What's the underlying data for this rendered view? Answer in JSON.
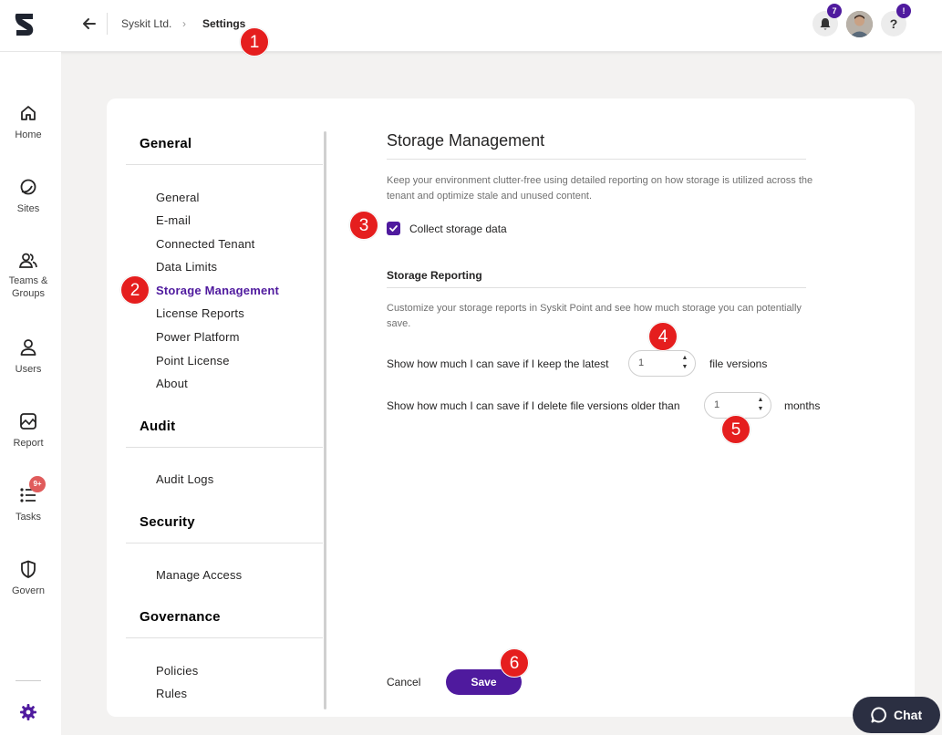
{
  "header": {
    "breadcrumb": {
      "org": "Syskit Ltd.",
      "chevron": "›",
      "current": "Settings"
    },
    "notifications_count": "7",
    "help_label": "?",
    "help_badge": "!"
  },
  "rail": {
    "items": [
      {
        "label": "Home",
        "icon": "home-icon"
      },
      {
        "label": "Sites",
        "icon": "sites-icon"
      },
      {
        "label": "Teams &\nGroups",
        "icon": "teams-icon"
      },
      {
        "label": "Users",
        "icon": "user-icon"
      },
      {
        "label": "Report",
        "icon": "report-icon"
      },
      {
        "label": "Tasks",
        "icon": "tasks-icon",
        "badge": "9+"
      },
      {
        "label": "Govern",
        "icon": "shield-icon"
      }
    ],
    "settings_icon": "gear-icon"
  },
  "settings_nav": {
    "sections": [
      {
        "title": "General",
        "items": [
          "General",
          "E-mail",
          "Connected Tenant",
          "Data Limits",
          "Storage Management",
          "License Reports",
          "Power Platform",
          "Point License",
          "About"
        ]
      },
      {
        "title": "Audit",
        "items": [
          "Audit Logs"
        ]
      },
      {
        "title": "Security",
        "items": [
          "Manage Access"
        ]
      },
      {
        "title": "Governance",
        "items": [
          "Policies",
          "Rules"
        ]
      }
    ],
    "active": "Storage Management"
  },
  "main": {
    "title": "Storage Management",
    "description": "Keep your environment clutter-free using detailed reporting on how storage is utilized across the tenant and optimize stale and unused content.",
    "collect_label": "Collect storage data",
    "collect_checked": true,
    "reporting_title": "Storage Reporting",
    "reporting_description": "Customize your storage reports in Syskit Point and see how much storage you can potentially save.",
    "keep_latest_prefix": "Show how much I can save if I keep the latest",
    "keep_latest_value": "1",
    "keep_latest_suffix": "file versions",
    "older_than_prefix": "Show how much I can save if I delete file versions older than",
    "older_than_value": "1",
    "older_than_suffix": "months"
  },
  "actions": {
    "cancel": "Cancel",
    "save": "Save"
  },
  "markers": [
    "1",
    "2",
    "3",
    "4",
    "5",
    "6"
  ],
  "chat": {
    "label": "Chat"
  },
  "colors": {
    "accent": "#4f1a9e",
    "marker": "#e51e1e",
    "chat_bg": "#2b2f42"
  }
}
